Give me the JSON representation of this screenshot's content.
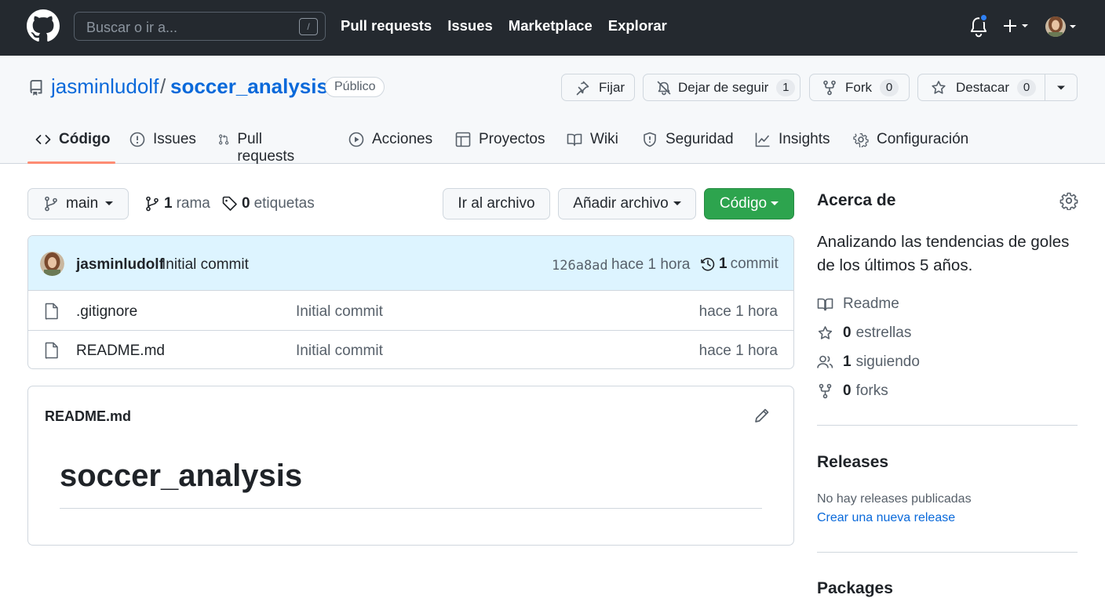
{
  "header": {
    "search_placeholder": "Buscar o ir a...",
    "search_shortcut": "/",
    "nav": [
      "Pull requests",
      "Issues",
      "Marketplace",
      "Explorar"
    ],
    "notification_dot_color": "#2f81f7"
  },
  "repo": {
    "owner": "jasminludolf",
    "separator": "/",
    "name": "soccer_analysis",
    "visibility": "Público",
    "actions": {
      "pin": "Fijar",
      "unwatch": "Dejar de seguir",
      "unwatch_count": "1",
      "fork": "Fork",
      "fork_count": "0",
      "star": "Destacar",
      "star_count": "0"
    },
    "tabs": [
      "Código",
      "Issues",
      "Pull requests",
      "Acciones",
      "Proyectos",
      "Wiki",
      "Seguridad",
      "Insights",
      "Configuración"
    ],
    "active_tab": "Código"
  },
  "main": {
    "branch": "main",
    "branches_count": "1",
    "branches_label": "rama",
    "tags_count": "0",
    "tags_label": "etiquetas",
    "go_to_file": "Ir al archivo",
    "add_file": "Añadir archivo",
    "code": "Código",
    "latest_commit": {
      "author": "jasminludolf",
      "message": "Initial commit",
      "sha": "126a8ad",
      "time": "hace 1 hora",
      "count": "1",
      "count_label": "commit"
    },
    "files": [
      {
        "name": ".gitignore",
        "message": "Initial commit",
        "time": "hace 1 hora"
      },
      {
        "name": "README.md",
        "message": "Initial commit",
        "time": "hace 1 hora"
      }
    ],
    "readme": {
      "filename": "README.md",
      "heading": "soccer_analysis"
    }
  },
  "sidebar": {
    "about_title": "Acerca de",
    "description": "Analizando las tendencias de goles de los últimos 5 años.",
    "readme": "Readme",
    "stars_count": "0",
    "stars_label": "estrellas",
    "watching_count": "1",
    "watching_label": "siguiendo",
    "forks_count": "0",
    "forks_label": "forks",
    "releases_title": "Releases",
    "releases_empty": "No hay releases publicadas",
    "releases_create": "Crear una nueva release",
    "packages_title": "Packages"
  },
  "colors": {
    "header_bg": "#24292f",
    "link": "#0969da",
    "code_button": "#2da44e",
    "active_tab_underline": "#fd8c73",
    "commit_header_bg": "#ddf4ff"
  }
}
